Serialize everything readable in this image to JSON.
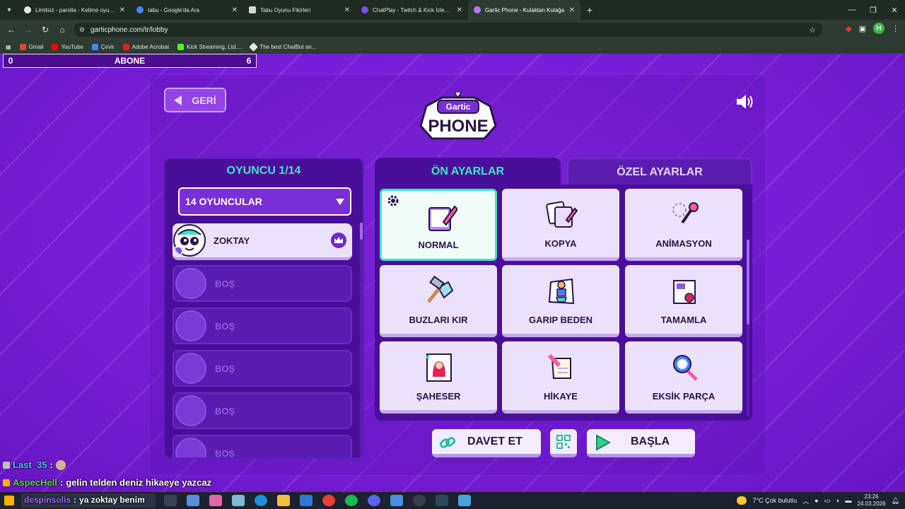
{
  "browser": {
    "tabs": [
      {
        "title": "Limitsiz - parolla - Kelime oyunu",
        "active": false
      },
      {
        "title": "tabu - Google'da Ara",
        "active": false
      },
      {
        "title": "Tabu Oyunu Fikirleri",
        "active": false
      },
      {
        "title": "ChatPlay - Twitch & Kick İzleyici",
        "active": false
      },
      {
        "title": "Gartic Phone - Kulaktan Kulağa",
        "active": true
      }
    ],
    "url": "garticphone.com/tr/lobby",
    "profile_initial": "H",
    "bookmarks": [
      "Gmail",
      "YouTube",
      "Çevir",
      "Adobe Acrobat",
      "Kick Streaming, Ltd....",
      "The best ChatBot an..."
    ]
  },
  "overlay": {
    "abone_left": "0",
    "abone_label": "ABONE",
    "abone_right": "6"
  },
  "lobby": {
    "back_label": "GERİ",
    "logo_top": "Gartic",
    "logo_bottom": "PHONE",
    "players_title": "OYUNCU 1/14",
    "player_count_select": "14 OYUNCULAR",
    "players": [
      {
        "name": "ZOKTAY",
        "filled": true
      },
      {
        "name": "BOŞ",
        "filled": false
      },
      {
        "name": "BOŞ",
        "filled": false
      },
      {
        "name": "BOŞ",
        "filled": false
      },
      {
        "name": "BOŞ",
        "filled": false
      },
      {
        "name": "BOŞ",
        "filled": false
      }
    ],
    "tab_presets": "ÖN AYARLAR",
    "tab_custom": "ÖZEL AYARLAR",
    "modes": [
      {
        "label": "NORMAL",
        "icon": "notepad-pencil-icon",
        "selected": true
      },
      {
        "label": "KOPYA",
        "icon": "copy-cards-icon"
      },
      {
        "label": "ANİMASYON",
        "icon": "animation-pen-icon"
      },
      {
        "label": "BUZLARI KIR",
        "icon": "hammer-ice-icon"
      },
      {
        "label": "GARIP BEDEN",
        "icon": "odd-body-icon"
      },
      {
        "label": "TAMAMLA",
        "icon": "puzzle-complete-icon"
      },
      {
        "label": "ŞAHESER",
        "icon": "masterpiece-icon"
      },
      {
        "label": "HİKAYE",
        "icon": "story-scroll-icon"
      },
      {
        "label": "EKSİK PARÇA",
        "icon": "missing-piece-icon"
      }
    ],
    "invite_label": "DAVET ET",
    "start_label": "BAŞLA"
  },
  "chat": [
    {
      "user": "Last_35",
      "message": ""
    },
    {
      "user": "AspecHell",
      "message": "gelin telden deniz hikaeye yazcaz"
    },
    {
      "user": "despinsolis",
      "message": "ya zoktay benim"
    }
  ],
  "taskbar": {
    "weather": "7°C  Çok bulutlu",
    "time": "23:26",
    "date": "24.03.2026"
  },
  "colors": {
    "accent_teal": "#3fe3c6",
    "panel_purple": "#4a0f9a",
    "background_purple": "#7b1fd6"
  }
}
